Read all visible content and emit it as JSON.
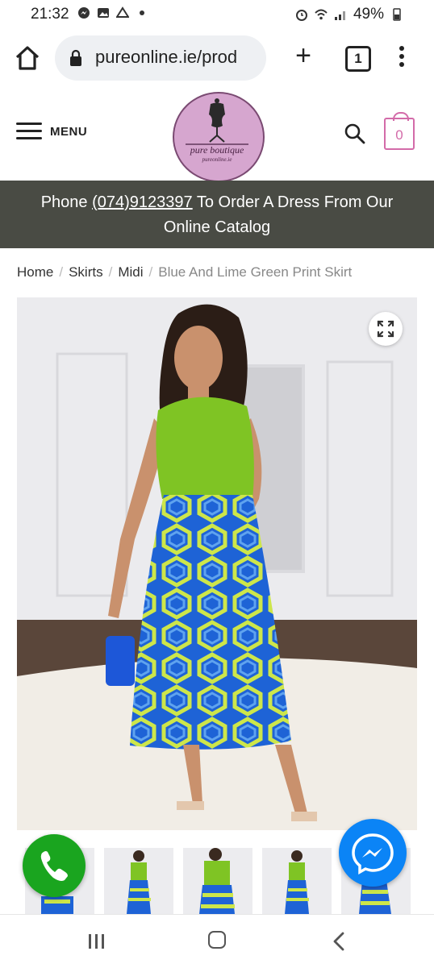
{
  "status_bar": {
    "time": "21:32",
    "battery": "49%",
    "notification_icons": [
      "messenger-icon",
      "gallery-icon",
      "drive-icon",
      "dot-icon"
    ],
    "system_icons": [
      "alarm-icon",
      "wifi-icon",
      "signal-icon",
      "battery-icon"
    ]
  },
  "browser": {
    "url": "pureonline.ie/prod",
    "tab_count": "1"
  },
  "site": {
    "menu_label": "MENU",
    "logo_text": "pure boutique",
    "logo_subtext": "pureonline.ie",
    "cart_count": "0",
    "accent_color": "#d36ba9"
  },
  "banner": {
    "prefix": "Phone ",
    "phone": "(074)9123397",
    "suffix": " To Order A Dress From Our Online Catalog",
    "background": "#494b44"
  },
  "breadcrumb": {
    "items": [
      "Home",
      "Skirts",
      "Midi"
    ],
    "current": "Blue And Lime Green Print Skirt",
    "separator": "/"
  },
  "colors": {
    "call_button": "#1aa51f",
    "messenger_button": "#0b84f6",
    "top_lime": "#7fc424",
    "skirt_blue": "#1e63d6",
    "skirt_lime": "#cde64a"
  }
}
